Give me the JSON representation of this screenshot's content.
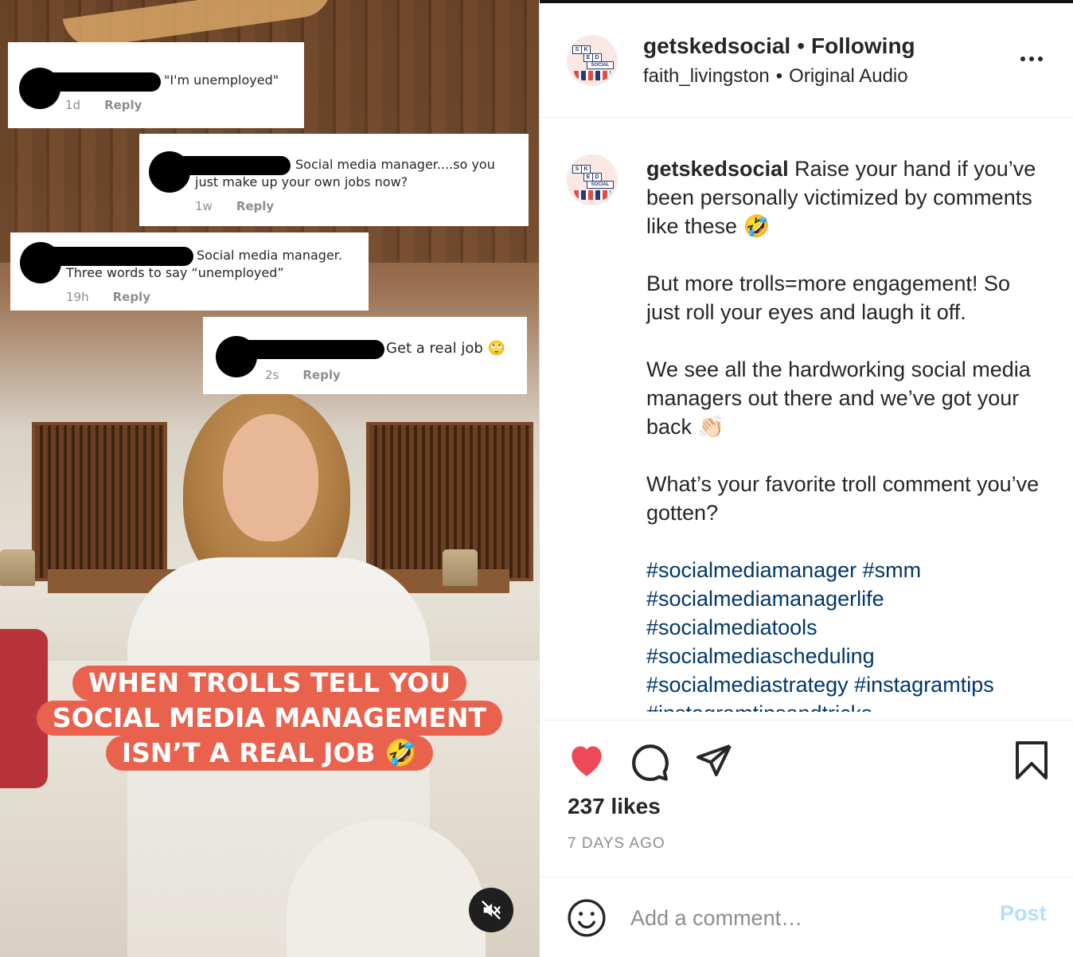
{
  "media": {
    "comments": [
      {
        "text": "\"I'm unemployed\"",
        "time": "1d",
        "reply": "Reply"
      },
      {
        "text": "Social media manager....so you",
        "text2": "just make up your own jobs now?",
        "time": "1w",
        "reply": "Reply"
      },
      {
        "text": "Social media manager.",
        "text2": "Three words to say “unemployed”",
        "time": "19h",
        "reply": "Reply"
      },
      {
        "text": "Get a real job 🙄",
        "time": "2s",
        "reply": "Reply"
      }
    ],
    "overlay_lines": [
      "WHEN TROLLS TELL YOU",
      "SOCIAL MEDIA MANAGEMENT",
      "ISN’T A REAL JOB 🤣"
    ]
  },
  "header": {
    "username": "getskedsocial",
    "follow_status": "Following",
    "separator": "•",
    "tagged_user": "faith_livingston",
    "audio": "Original Audio"
  },
  "caption": {
    "username": "getskedsocial",
    "paragraphs": [
      "Raise your hand if you’ve been personally victimized by comments like these 🤣",
      "But more trolls=more engagement! So just roll your eyes and laugh it off.",
      "We see all the hardworking social media managers out there and we’ve got your back 👏🏻",
      "What’s your favorite troll comment you’ve gotten?"
    ],
    "hashtags": "#socialmediamanager #smm #socialmediamanagerlife #socialmediatools #socialmediascheduling #socialmediastrategy #instagramtips #instagramtipsandtricks"
  },
  "actions": {
    "likes": "237 likes",
    "posted": "7 DAYS AGO",
    "liked": true,
    "like_color": "#ed4956"
  },
  "comment_box": {
    "placeholder": "Add a comment…",
    "post_label": "Post",
    "post_color": "#b2dffc"
  },
  "avatar_logo_text": [
    "S",
    "K",
    "E",
    "D",
    "SOCIAL"
  ],
  "accent_colors": {
    "link": "#00376b",
    "overlay": "#e9624e"
  }
}
